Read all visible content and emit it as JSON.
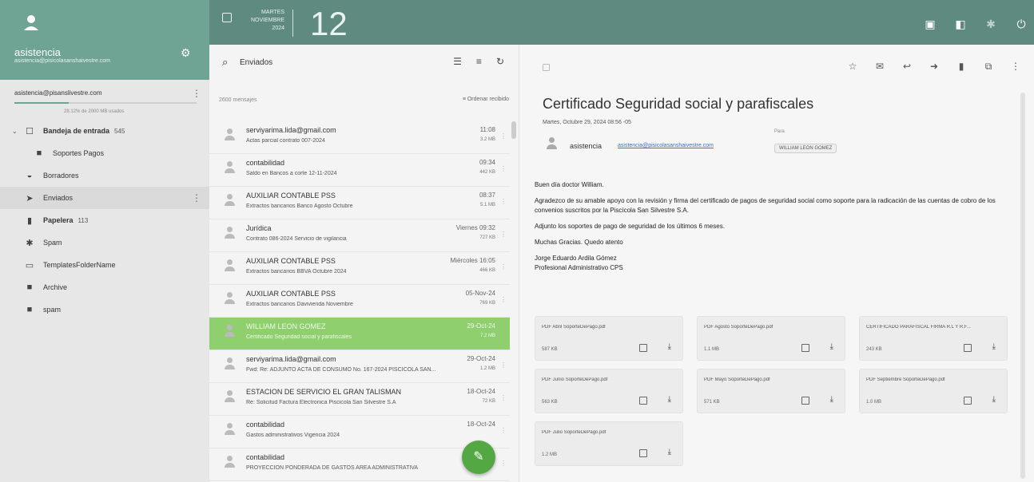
{
  "colors": {
    "topbar": "#5e8a80",
    "account_header": "#6fa394",
    "selected_row": "#8fcf6e",
    "fab": "#53a844",
    "link": "#3b6fbf"
  },
  "header": {
    "user_name": "asistencia",
    "user_email": "asistencia@pisicolasanshaivestre.com",
    "weekday": "MARTES",
    "month": "NOVIEMBRE",
    "year": "2024",
    "day": "12",
    "icons": [
      "calendar-icon",
      "contacts-icon",
      "settings-icon",
      "power-icon"
    ]
  },
  "sidebar": {
    "account": "asistencia@pisanslivestre.com",
    "quota_fraction": 0.3,
    "quota_text": "28.12% de 2000 MB usados",
    "items": [
      {
        "label": "Bandeja de entrada",
        "count": "545",
        "icon": "inbox-icon",
        "caret": "⌄",
        "bold": true
      },
      {
        "label": "Soportes Pagos",
        "count": "",
        "icon": "folder-icon",
        "sub": true
      },
      {
        "label": "Borradores",
        "count": "",
        "icon": "drafts-icon"
      },
      {
        "label": "Enviados",
        "count": "",
        "icon": "send-icon",
        "active": true
      },
      {
        "label": "Papelera",
        "count": "113",
        "icon": "trash-icon",
        "bold": true
      },
      {
        "label": "Spam",
        "count": "",
        "icon": "spam-icon"
      },
      {
        "label": "TemplatesFolderName",
        "count": "",
        "icon": "templates-icon"
      },
      {
        "label": "Archive",
        "count": "",
        "icon": "folder-icon"
      },
      {
        "label": "spam",
        "count": "",
        "icon": "folder-icon"
      }
    ]
  },
  "list": {
    "search_value": "Enviados",
    "message_count": "2600 mensajes",
    "order_label": "Ordenar recibido",
    "rows": [
      {
        "from": "serviyarima.lida@gmail.com",
        "subject": "Actas parcial contrato 007-2024",
        "time": "11:08",
        "size": "3.2 MB"
      },
      {
        "from": "contabilidad",
        "subject": "Saldo en Bancos a corte 12-11-2024",
        "time": "09:34",
        "size": "442 KB"
      },
      {
        "from": "AUXILIAR CONTABLE PSS",
        "subject": "Extractos bancarios Banco Agosto Octubre",
        "time": "08:37",
        "size": "5.1 MB"
      },
      {
        "from": "Jurídica",
        "subject": "Contrato 086-2024 Servicio de vigilancia",
        "time": "Viernes 09:32",
        "size": "727 KB"
      },
      {
        "from": "AUXILIAR CONTABLE PSS",
        "subject": "Extractos bancarios BBVA Octubre 2024",
        "time": "Miércoles 16:05",
        "size": "466 KB"
      },
      {
        "from": "AUXILIAR CONTABLE PSS",
        "subject": "Extractos bancarios Davivienda Noviembre",
        "time": "05-Nov-24",
        "size": "769 KB"
      },
      {
        "from": "WILLIAM LEON GOMEZ",
        "subject": "Certificado Seguridad social y parafiscales",
        "time": "29-Oct-24",
        "size": "7.2 MB",
        "selected": true
      },
      {
        "from": "serviyarima.lida@gmail.com",
        "subject": "Fwd: Re: ADJUNTO ACTA DE CONSUMO No. 167-2024 PISCICOLA SAN...",
        "time": "29-Oct-24",
        "size": "1.2 MB"
      },
      {
        "from": "ESTACION DE SERVICIO EL GRAN TALISMAN",
        "subject": "Re: Solicitud Factura Electronica Piscicola San Silvestre S.A",
        "time": "18-Oct-24",
        "size": "72 KB"
      },
      {
        "from": "contabilidad",
        "subject": "Gastos administrativos Vigencia 2024",
        "time": "18-Oct-24",
        "size": ""
      },
      {
        "from": "contabilidad",
        "subject": "PROYECCION PONDERADA DE GASTOS AREA ADMINISTRATIVA",
        "time": "",
        "size": ""
      }
    ]
  },
  "reader": {
    "subject": "Certificado Seguridad social y parafiscales",
    "date": "Martes, Octubre 29, 2024 08:56 -05",
    "sender_name": "asistencia",
    "sender_email": "asistencia@pisicolasanshaivestre.com",
    "to_label": "Para",
    "to": "WILLIAM LEON GOMEZ",
    "body": [
      "Buen día doctor William.",
      "Agradezco de su amable apoyo con la revisión y firma del certificado de pagos de seguridad social como soporte para la radicación de las cuentas de cobro de los convenios suscritos por la Piscícola San Silvestre S.A.",
      "Adjunto los soportes de pago de seguridad de los últimos 6 meses.",
      "Muchas Gracias. Quedo atento",
      "Jorge Eduardo Ardila Gómez",
      "Profesional Administrativo CPS"
    ],
    "attachments": [
      {
        "name": "PDF Abril SoporteDePago.pdf",
        "size": "587 KB"
      },
      {
        "name": "PDF Agosto SoporteDePago.pdf",
        "size": "1.1 MB"
      },
      {
        "name": "CERTIFICADO PARAFISCAL FIRMA R.L Y R.F...",
        "size": "243 KB"
      },
      {
        "name": "PDF Junio SoporteDePago.pdf",
        "size": "563 KB"
      },
      {
        "name": "PDF Mayo SoporteDePago.pdf",
        "size": "571 KB"
      },
      {
        "name": "PDF Septiembre SoporteDePago.pdf",
        "size": "1.0 MB"
      },
      {
        "name": "PDF Julio SoporteDePago.pdf",
        "size": "1.2 MB"
      }
    ]
  }
}
